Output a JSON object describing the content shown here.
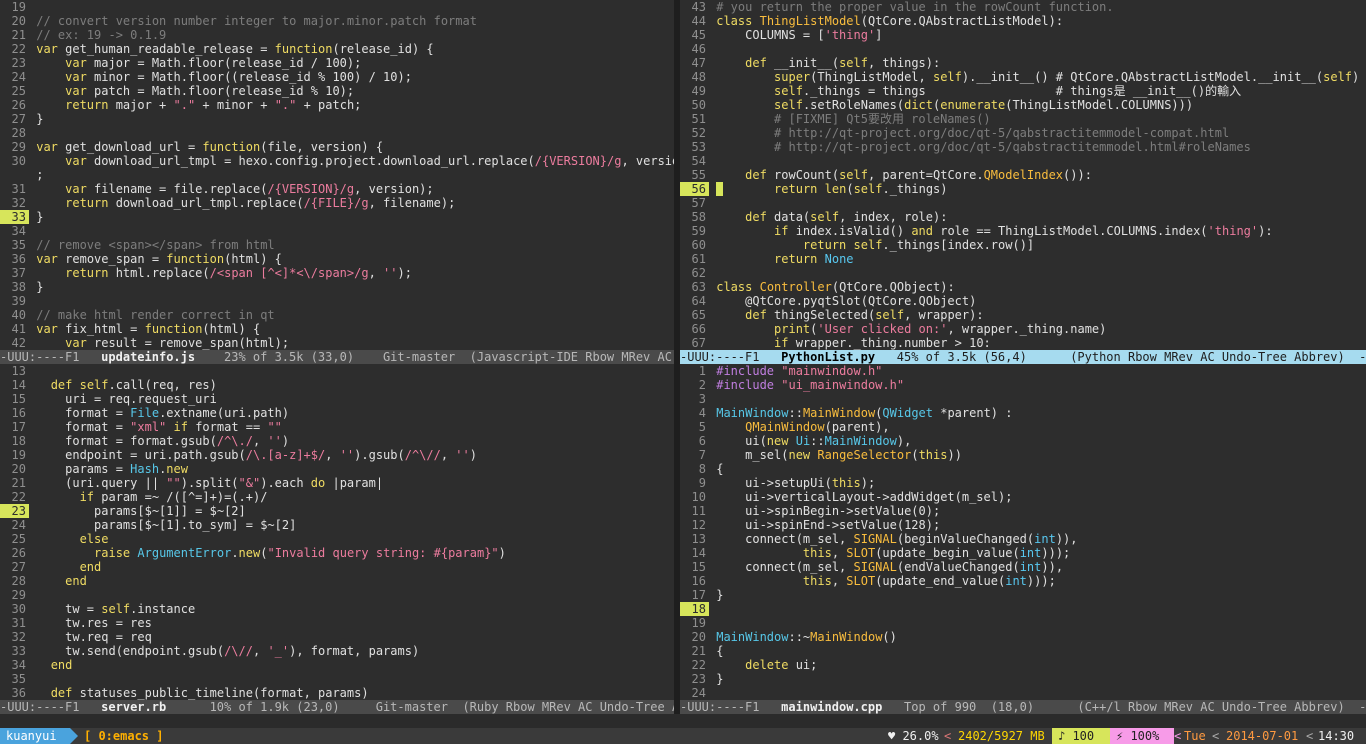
{
  "colors": {
    "accent": "#d7e55b",
    "active_modeline": "#a6dbef",
    "session_tab": "#4aa3dd",
    "window_tab": "#ffd700"
  },
  "panes": [
    {
      "modeline": {
        "status": "-UUU:----F1",
        "filename": "updateinfo.js",
        "position": "23% of 3.5k (33,0)",
        "branch": "Git-master",
        "modes": "(Javascript-IDE Rbow MRev AC Undo-Tree Abbrev)"
      },
      "lines": [
        {
          "n": "19",
          "t": ""
        },
        {
          "n": "20",
          "t": "// convert version number integer to major.minor.patch format"
        },
        {
          "n": "21",
          "t": "// ex: 19 -> 0.1.9"
        },
        {
          "n": "22",
          "t": "var get_human_readable_release = function(release_id) {"
        },
        {
          "n": "23",
          "t": "    var major = Math.floor(release_id / 100);"
        },
        {
          "n": "24",
          "t": "    var minor = Math.floor((release_id % 100) / 10);"
        },
        {
          "n": "25",
          "t": "    var patch = Math.floor(release_id % 10);"
        },
        {
          "n": "26",
          "t": "    return major + \".\" + minor + \".\" + patch;"
        },
        {
          "n": "27",
          "t": "}"
        },
        {
          "n": "28",
          "t": ""
        },
        {
          "n": "29",
          "t": "var get_download_url = function(file, version) {"
        },
        {
          "n": "30",
          "t": "    var download_url_tmpl = hexo.config.project.download_url.replace(/{VERSION}/g, version)\\"
        },
        {
          "n": "",
          "t": ";"
        },
        {
          "n": "31",
          "t": "    var filename = file.replace(/{VERSION}/g, version);"
        },
        {
          "n": "32",
          "t": "    return download_url_tmpl.replace(/{FILE}/g, filename);"
        },
        {
          "n": "33",
          "t": "}"
        },
        {
          "n": "34",
          "t": ""
        },
        {
          "n": "35",
          "t": "// remove <span></span> from html"
        },
        {
          "n": "36",
          "t": "var remove_span = function(html) {"
        },
        {
          "n": "37",
          "t": "    return html.replace(/<span [^<]*<\\/span>/g, '');"
        },
        {
          "n": "38",
          "t": "}"
        },
        {
          "n": "39",
          "t": ""
        },
        {
          "n": "40",
          "t": "// make html render correct in qt"
        },
        {
          "n": "41",
          "t": "var fix_html = function(html) {"
        },
        {
          "n": "42",
          "t": "    var result = remove_span(html);"
        }
      ]
    },
    {
      "modeline": {
        "status": "-UUU:----F1",
        "filename": "PythonList.py",
        "position": "45% of 3.5k (56,4)",
        "branch": "",
        "modes": "(Python Rbow MRev AC Undo-Tree Abbrev)  -----"
      },
      "lines": [
        {
          "n": "43",
          "t": "# you return the proper value in the rowCount function."
        },
        {
          "n": "44",
          "t": "class ThingListModel(QtCore.QAbstractListModel):"
        },
        {
          "n": "45",
          "t": "    COLUMNS = ['thing']"
        },
        {
          "n": "46",
          "t": ""
        },
        {
          "n": "47",
          "t": "    def __init__(self, things):"
        },
        {
          "n": "48",
          "t": "        super(ThingListModel, self).__init__() # QtCore.QAbstractListModel.__init__(self)"
        },
        {
          "n": "49",
          "t": "        self._things = things                  # things是 __init__()的輸入"
        },
        {
          "n": "50",
          "t": "        self.setRoleNames(dict(enumerate(ThingListModel.COLUMNS)))"
        },
        {
          "n": "51",
          "t": "        # [FIXME] Qt5要改用 roleNames()"
        },
        {
          "n": "52",
          "t": "        # http://qt-project.org/doc/qt-5/qabstractitemmodel-compat.html"
        },
        {
          "n": "53",
          "t": "        # http://qt-project.org/doc/qt-5/qabstractitemmodel.html#roleNames"
        },
        {
          "n": "54",
          "t": ""
        },
        {
          "n": "55",
          "t": "    def rowCount(self, parent=QtCore.QModelIndex()):"
        },
        {
          "n": "56",
          "t": "        return len(self._things)"
        },
        {
          "n": "57",
          "t": ""
        },
        {
          "n": "58",
          "t": "    def data(self, index, role):"
        },
        {
          "n": "59",
          "t": "        if index.isValid() and role == ThingListModel.COLUMNS.index('thing'):"
        },
        {
          "n": "60",
          "t": "            return self._things[index.row()]"
        },
        {
          "n": "61",
          "t": "        return None"
        },
        {
          "n": "62",
          "t": ""
        },
        {
          "n": "63",
          "t": "class Controller(QtCore.QObject):"
        },
        {
          "n": "64",
          "t": "    @QtCore.pyqtSlot(QtCore.QObject)"
        },
        {
          "n": "65",
          "t": "    def thingSelected(self, wrapper):"
        },
        {
          "n": "66",
          "t": "        print('User clicked on:', wrapper._thing.name)"
        },
        {
          "n": "67",
          "t": "        if wrapper._thing.number > 10:"
        }
      ]
    },
    {
      "modeline": {
        "status": "-UUU:----F1",
        "filename": "server.rb",
        "position": "10% of 1.9k (23,0)",
        "branch": "Git-master",
        "modes": "(Ruby Rbow MRev AC Undo-Tree Abbrev)"
      },
      "lines": [
        {
          "n": "13",
          "t": ""
        },
        {
          "n": "14",
          "t": "  def self.call(req, res)"
        },
        {
          "n": "15",
          "t": "    uri = req.request_uri"
        },
        {
          "n": "16",
          "t": "    format = File.extname(uri.path)"
        },
        {
          "n": "17",
          "t": "    format = \"xml\" if format == \"\""
        },
        {
          "n": "18",
          "t": "    format = format.gsub(/^\\./, '')"
        },
        {
          "n": "19",
          "t": "    endpoint = uri.path.gsub(/\\.[a-z]+$/, '').gsub(/^\\//, '')"
        },
        {
          "n": "20",
          "t": "    params = Hash.new"
        },
        {
          "n": "21",
          "t": "    (uri.query || \"\").split(\"&\").each do |param|"
        },
        {
          "n": "22",
          "t": "      if param =~ /([^=]+)=(.+)/"
        },
        {
          "n": "23",
          "t": "        params[$~[1]] = $~[2]"
        },
        {
          "n": "24",
          "t": "        params[$~[1].to_sym] = $~[2]"
        },
        {
          "n": "25",
          "t": "      else"
        },
        {
          "n": "26",
          "t": "        raise ArgumentError.new(\"Invalid query string: #{param}\")"
        },
        {
          "n": "27",
          "t": "      end"
        },
        {
          "n": "28",
          "t": "    end"
        },
        {
          "n": "29",
          "t": ""
        },
        {
          "n": "30",
          "t": "    tw = self.instance"
        },
        {
          "n": "31",
          "t": "    tw.res = res"
        },
        {
          "n": "32",
          "t": "    tw.req = req"
        },
        {
          "n": "33",
          "t": "    tw.send(endpoint.gsub(/\\//, '_'), format, params)"
        },
        {
          "n": "34",
          "t": "  end"
        },
        {
          "n": "35",
          "t": ""
        },
        {
          "n": "36",
          "t": "  def statuses_public_timeline(format, params)"
        }
      ]
    },
    {
      "modeline": {
        "status": "-UUU:----F1",
        "filename": "mainwindow.cpp",
        "position": "Top of 990  (18,0)",
        "branch": "",
        "modes": "(C++/l Rbow MRev AC Undo-Tree Abbrev)  -----"
      },
      "lines": [
        {
          "n": "1",
          "t": "#include \"mainwindow.h\""
        },
        {
          "n": "2",
          "t": "#include \"ui_mainwindow.h\""
        },
        {
          "n": "3",
          "t": ""
        },
        {
          "n": "4",
          "t": "MainWindow::MainWindow(QWidget *parent) :"
        },
        {
          "n": "5",
          "t": "    QMainWindow(parent),"
        },
        {
          "n": "6",
          "t": "    ui(new Ui::MainWindow),"
        },
        {
          "n": "7",
          "t": "    m_sel(new RangeSelector(this))"
        },
        {
          "n": "8",
          "t": "{"
        },
        {
          "n": "9",
          "t": "    ui->setupUi(this);"
        },
        {
          "n": "10",
          "t": "    ui->verticalLayout->addWidget(m_sel);"
        },
        {
          "n": "11",
          "t": "    ui->spinBegin->setValue(0);"
        },
        {
          "n": "12",
          "t": "    ui->spinEnd->setValue(128);"
        },
        {
          "n": "13",
          "t": "    connect(m_sel, SIGNAL(beginValueChanged(int)),"
        },
        {
          "n": "14",
          "t": "            this, SLOT(update_begin_value(int)));"
        },
        {
          "n": "15",
          "t": "    connect(m_sel, SIGNAL(endValueChanged(int)),"
        },
        {
          "n": "16",
          "t": "            this, SLOT(update_end_value(int)));"
        },
        {
          "n": "17",
          "t": "}"
        },
        {
          "n": "18",
          "t": ""
        },
        {
          "n": "19",
          "t": ""
        },
        {
          "n": "20",
          "t": "MainWindow::~MainWindow()"
        },
        {
          "n": "21",
          "t": "{"
        },
        {
          "n": "22",
          "t": "    delete ui;"
        },
        {
          "n": "23",
          "t": "}"
        },
        {
          "n": "24",
          "t": ""
        }
      ]
    }
  ],
  "tmux": {
    "session": "kuanyui",
    "window": "[ 0:emacs ]",
    "battery": "♥ 26.0%",
    "memory": "2402/5927 MB",
    "volume": "♪ 100",
    "brightness": "⚡ 100%",
    "day": "Tue",
    "date": "2014-07-01",
    "time": "14:30"
  }
}
